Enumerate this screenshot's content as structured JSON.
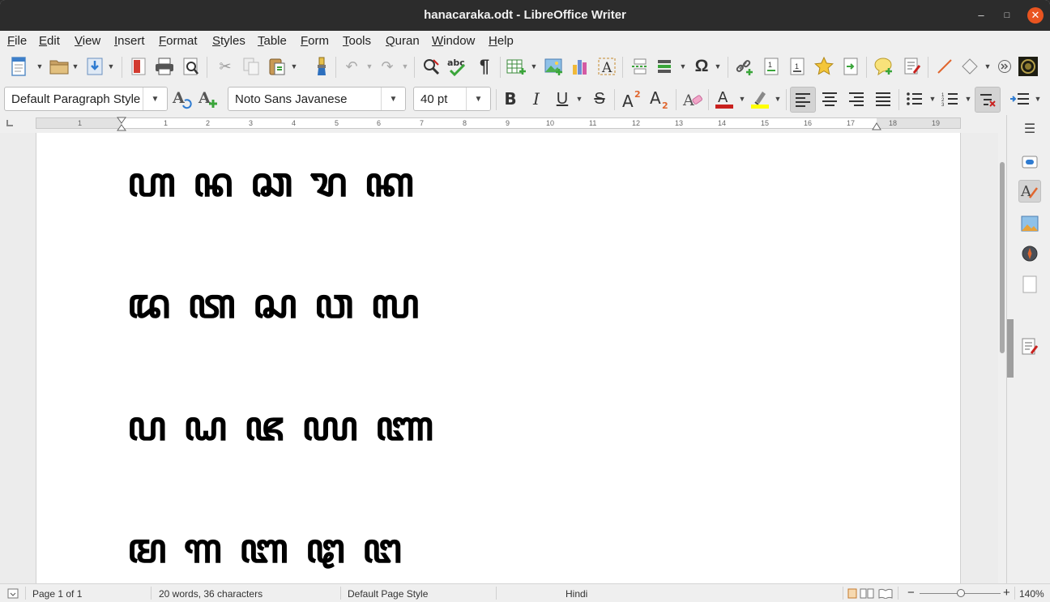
{
  "window": {
    "title": "hanacaraka.odt - LibreOffice Writer",
    "controls": {
      "minimize": "–",
      "maximize": "□",
      "close": "✕"
    }
  },
  "menubar": {
    "items": [
      "File",
      "Edit",
      "View",
      "Insert",
      "Format",
      "Styles",
      "Table",
      "Form",
      "Tools",
      "Quran",
      "Window",
      "Help"
    ]
  },
  "toolbar": {
    "paragraph_style": "Default Paragraph Style",
    "font_name": "Noto Sans Javanese",
    "font_size": "40 pt"
  },
  "document": {
    "lines": [
      "ꦲ ꦤ ꦕ ꦫ ꦏ",
      "ꦢ ꦠ ꦱ ꦮ ꦭ",
      "ꦥ ꦝ ꦗ ꦪ ꦚ",
      "ꦩ ꦒ ꦧ ꦛ ꦔ"
    ]
  },
  "ruler": {
    "numbers": [
      "1",
      "1",
      "2",
      "3",
      "4",
      "5",
      "6",
      "7",
      "8",
      "9",
      "10",
      "11",
      "12",
      "13",
      "14",
      "15",
      "16",
      "17",
      "18",
      "19"
    ]
  },
  "statusbar": {
    "page": "Page 1 of 1",
    "words": "20 words, 36 characters",
    "page_style": "Default Page Style",
    "language": "Hindi",
    "zoom_minus": "−",
    "zoom_plus": "+",
    "zoom": "140%"
  },
  "colors": {
    "titlebar": "#2c2c2c",
    "close_button": "#e95420",
    "font_color_bar": "#c9211e",
    "highlight_bar": "#ffff00"
  }
}
